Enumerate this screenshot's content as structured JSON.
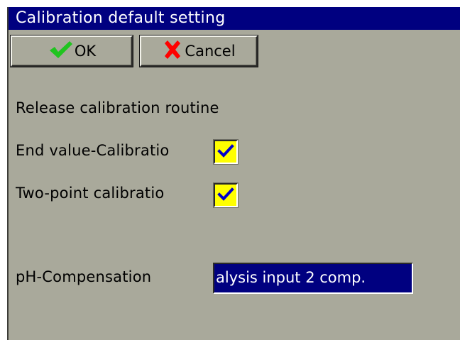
{
  "window": {
    "title": "Calibration default setting"
  },
  "toolbar": {
    "ok_label": "OK",
    "cancel_label": "Cancel",
    "ok_icon": "green-checkmark-icon",
    "cancel_icon": "red-x-icon"
  },
  "content": {
    "section_label": "Release calibration routine",
    "end_value": {
      "label": "End value-Calibratio",
      "checked": true
    },
    "two_point": {
      "label": "Two-point calibratio",
      "checked": true
    },
    "ph_compensation": {
      "label": "pH-Compensation",
      "value": "alysis input 2 comp."
    }
  },
  "colors": {
    "window_bg": "#a9a99b",
    "title_bg": "#000080",
    "checkbox_bg": "#ffff00",
    "check_mark": "#0000cc",
    "ok_icon": "#1fc41f",
    "cancel_icon": "#ff0000",
    "select_bg": "#000080"
  }
}
